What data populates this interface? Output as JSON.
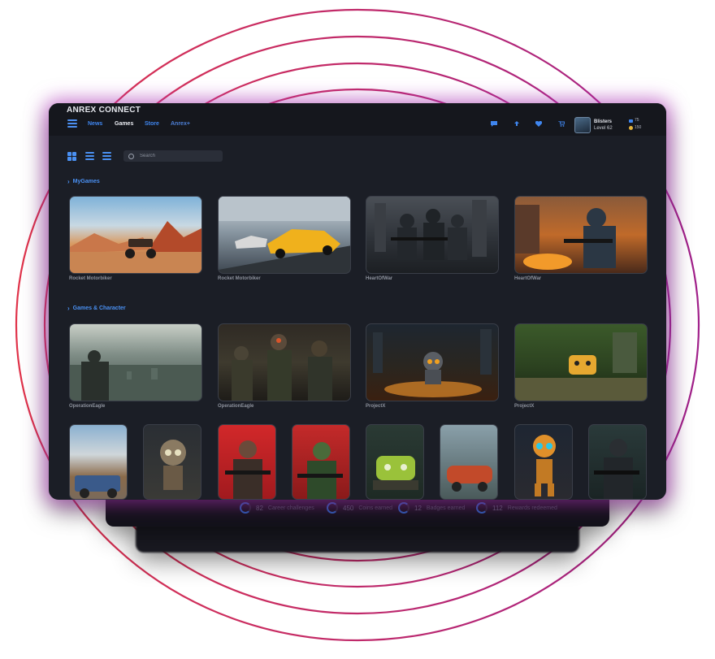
{
  "app": {
    "title": "ANREX CONNECT"
  },
  "nav": {
    "items": [
      "News",
      "Games",
      "Store",
      "Anrex+"
    ],
    "active": "Games"
  },
  "topbar_icons": [
    "chat-icon",
    "share-icon",
    "heart-icon",
    "cart-icon"
  ],
  "profile": {
    "name": "Blisters",
    "level": "Level 62"
  },
  "currency": {
    "blue": "75",
    "gold": "150"
  },
  "search": {
    "placeholder": "Search"
  },
  "sections": {
    "my_games": "MyGames",
    "games_character": "Games & Character"
  },
  "my_games": [
    {
      "title": "Rocket Motorbiker"
    },
    {
      "title": "Rocket Motorbiker"
    },
    {
      "title": "HeartOfWar"
    },
    {
      "title": "HeartOfWar"
    }
  ],
  "games_character": [
    {
      "title": "OperationEagle"
    },
    {
      "title": "OperationEagle"
    },
    {
      "title": "ProjectX"
    },
    {
      "title": "ProjectX"
    }
  ],
  "stats": [
    {
      "value": "82",
      "label": "Career challenges"
    },
    {
      "value": "450",
      "label": "Coins earned"
    },
    {
      "value": "12",
      "label": "Badges earned"
    },
    {
      "value": "112",
      "label": "Rewards redeemed"
    }
  ],
  "colors": {
    "accent": "#3f86ef",
    "glow": "#be3cc8",
    "ring_red": "#e0334a",
    "ring_purple": "#a0208a"
  }
}
